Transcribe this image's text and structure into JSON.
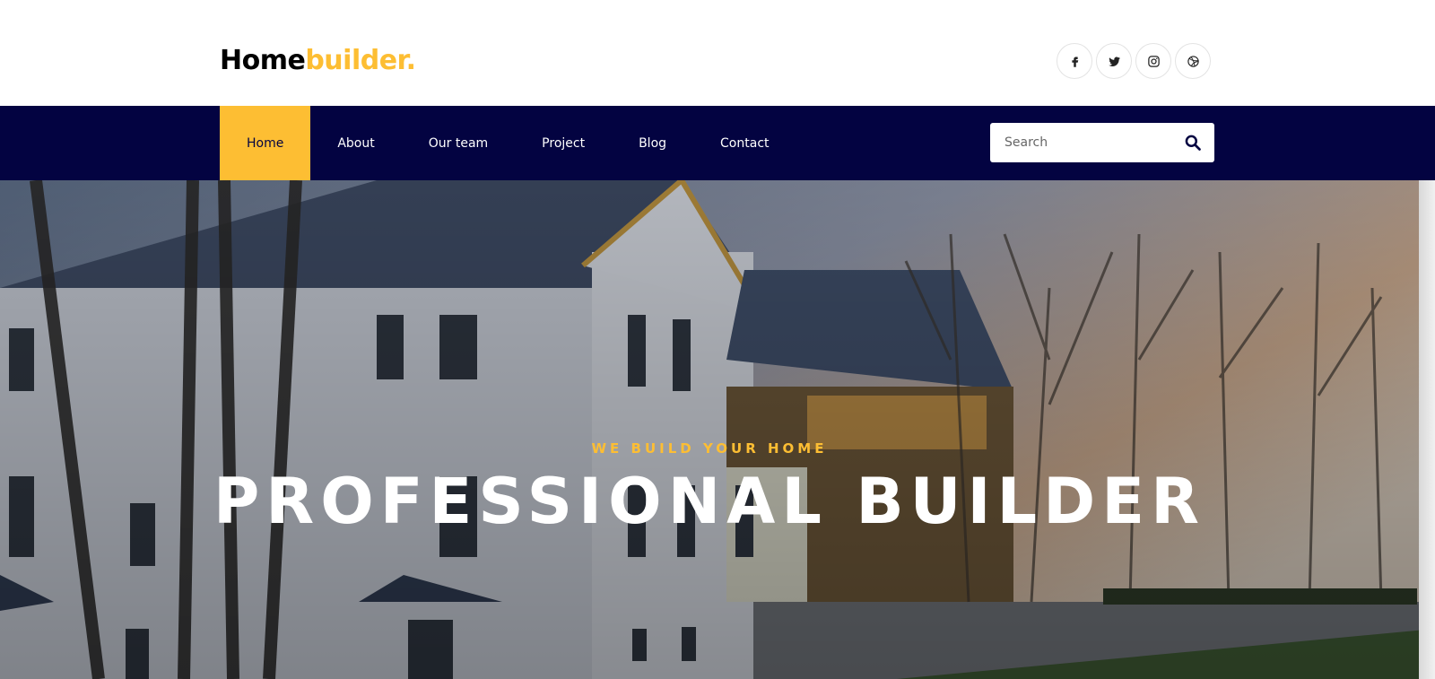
{
  "header": {
    "logo_main": "Home",
    "logo_accent": "builder.",
    "social_icons": [
      "facebook-icon",
      "twitter-icon",
      "instagram-icon",
      "dribbble-icon"
    ]
  },
  "nav": {
    "items": [
      {
        "label": "Home",
        "active": true
      },
      {
        "label": "About",
        "active": false
      },
      {
        "label": "Our team",
        "active": false
      },
      {
        "label": "Project",
        "active": false
      },
      {
        "label": "Blog",
        "active": false
      },
      {
        "label": "Contact",
        "active": false
      }
    ],
    "search_placeholder": "Search"
  },
  "hero": {
    "subtitle": "WE BUILD YOUR HOME",
    "title": "PROFESSIONAL BUILDER"
  },
  "colors": {
    "accent": "#fdbe33",
    "navbar": "#030341",
    "text_dark": "#000000"
  }
}
